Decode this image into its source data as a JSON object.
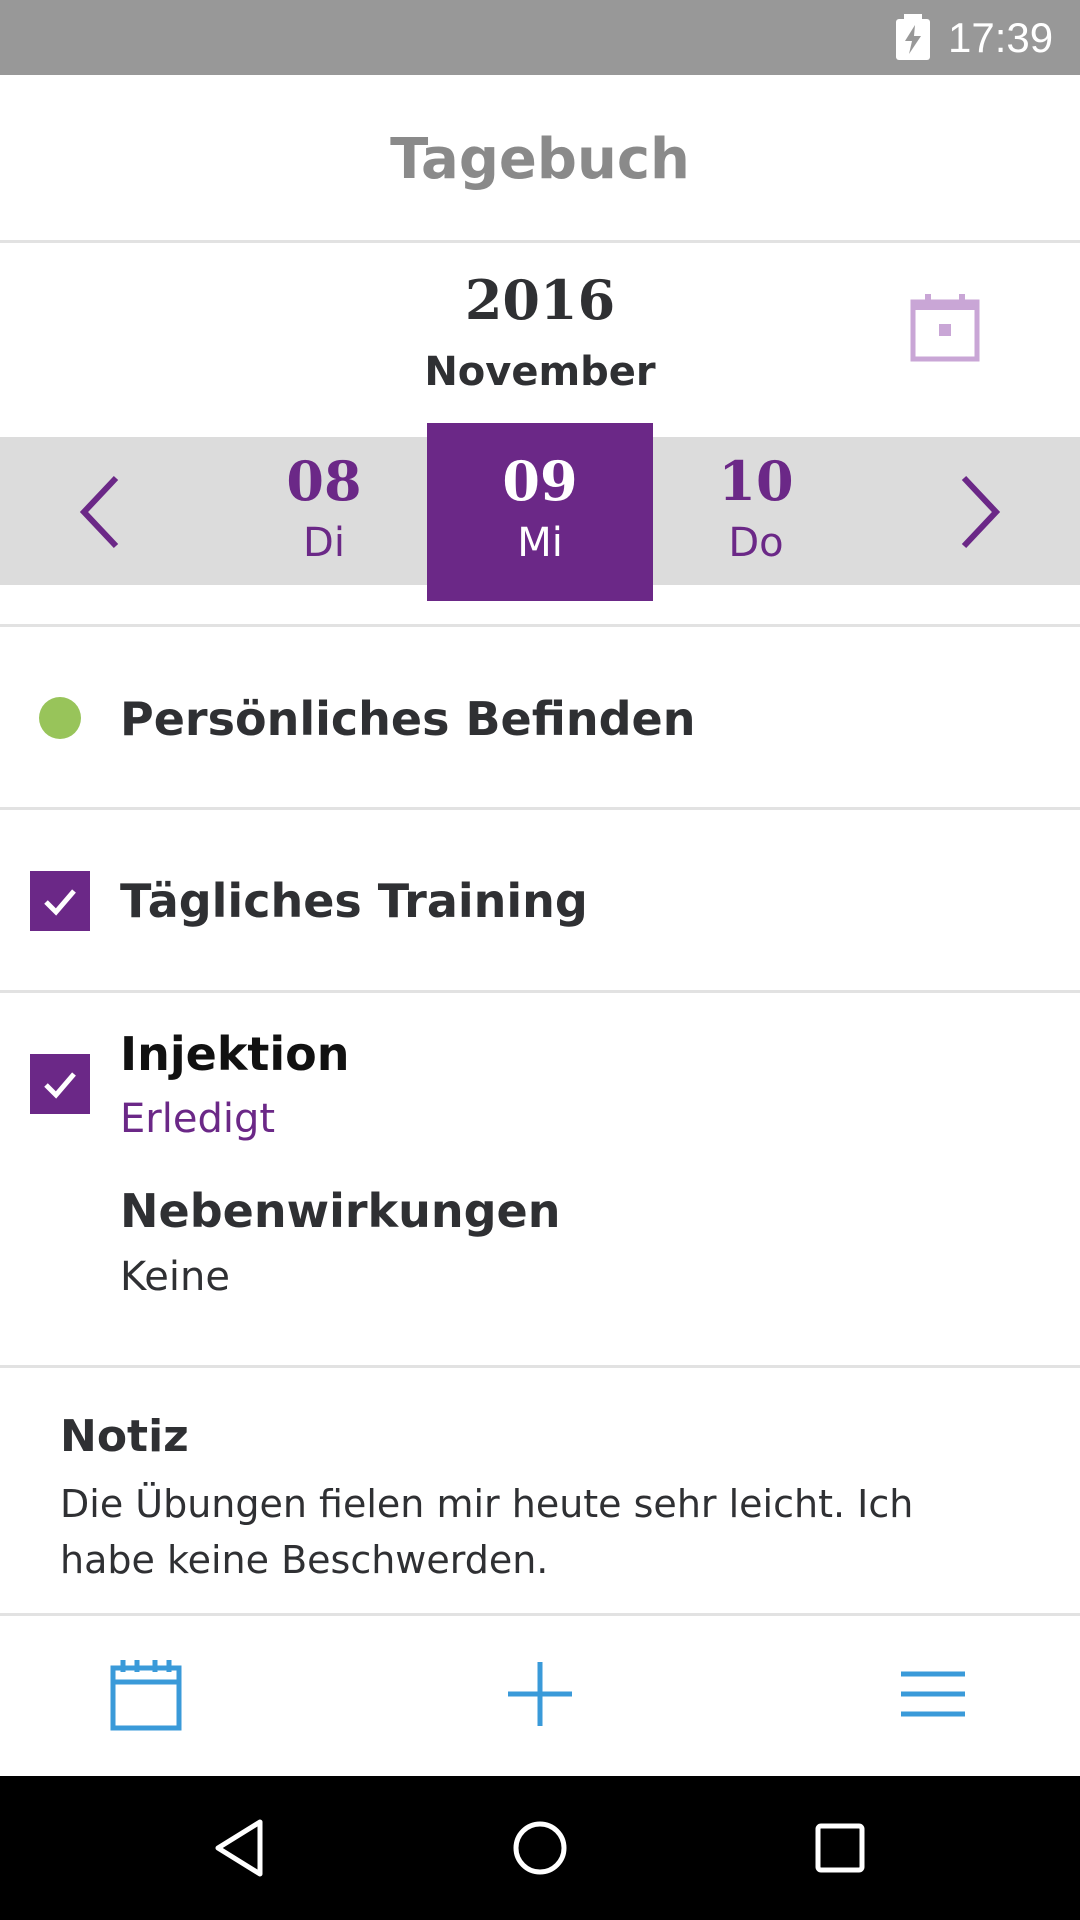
{
  "status_bar": {
    "time": "17:39"
  },
  "header": {
    "title": "Tagebuch"
  },
  "date": {
    "year": "2016",
    "month": "November"
  },
  "days": [
    {
      "number": "08",
      "name": "Di"
    },
    {
      "number": "09",
      "name": "Mi"
    },
    {
      "number": "10",
      "name": "Do"
    }
  ],
  "selected_day_index": 1,
  "entries": {
    "wellbeing": {
      "title": "Persönliches Befinden"
    },
    "training": {
      "title": "Tägliches Training",
      "checked": true
    },
    "injection": {
      "title": "Injektion",
      "status": "Erledigt",
      "checked": true,
      "side_effects_label": "Nebenwirkungen",
      "side_effects_value": "Keine"
    }
  },
  "note": {
    "label": "Notiz",
    "text": "Die Übungen fielen mir heute sehr leicht. Ich habe keine Beschwerden."
  },
  "colors": {
    "accent": "#6b2887",
    "wellbeing_dot": "#98c45a",
    "nav_icons": "#3a9ad9"
  }
}
